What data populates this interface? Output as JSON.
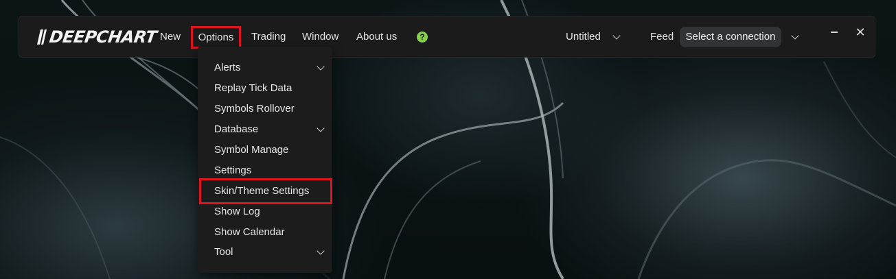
{
  "app": {
    "logo_text": "DEEPCHART"
  },
  "menubar": {
    "items": [
      "New",
      "Options",
      "Trading",
      "Window",
      "About us"
    ],
    "help_icon": "help-circle-icon"
  },
  "workspace": {
    "name": "Untitled"
  },
  "feed": {
    "label": "Feed",
    "connection_value": "Select a connection"
  },
  "window_controls": {
    "minimize_icon": "minimize-icon",
    "close_symbol": "✕"
  },
  "options_menu": {
    "items": [
      {
        "label": "Alerts",
        "has_submenu": true
      },
      {
        "label": "Replay Tick Data",
        "has_submenu": false
      },
      {
        "label": "Symbols Rollover",
        "has_submenu": false
      },
      {
        "label": "Database",
        "has_submenu": true
      },
      {
        "label": "Symbol Manage",
        "has_submenu": false
      },
      {
        "label": "Settings",
        "has_submenu": false
      },
      {
        "label": "Skin/Theme Settings",
        "has_submenu": false
      },
      {
        "label": "Show Log",
        "has_submenu": false
      },
      {
        "label": "Show Calendar",
        "has_submenu": false
      },
      {
        "label": "Tool",
        "has_submenu": true
      }
    ]
  },
  "colors": {
    "highlight_border": "#e0141e",
    "help_icon": "#86d14c",
    "topbar_bg": "#1b1b1c",
    "menu_bg": "#1c1c1d"
  }
}
